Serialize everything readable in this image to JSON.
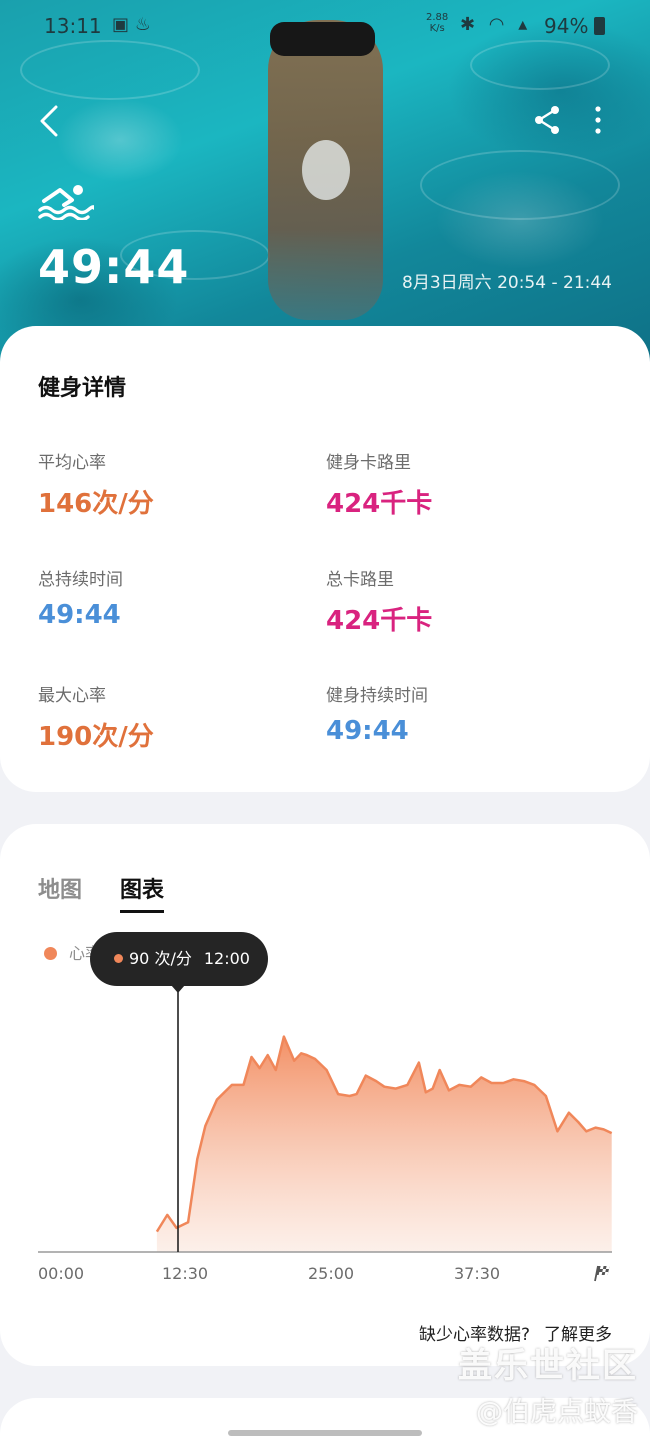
{
  "status_bar": {
    "time": "13:11",
    "left_icons": "▣ ♨",
    "net_speed_value": "2.88",
    "net_speed_unit": "K/s",
    "icons": "✱ ◠ ▴",
    "battery": "94%"
  },
  "hero": {
    "duration": "49:44",
    "date_range": "8月3日周六 20:54 - 21:44"
  },
  "details": {
    "title": "健身详情",
    "metrics": [
      {
        "label": "平均心率",
        "value": "146次/分",
        "color": "#e0713b"
      },
      {
        "label": "健身卡路里",
        "value": "424千卡",
        "color": "#d9237f"
      },
      {
        "label": "总持续时间",
        "value": "49:44",
        "color": "#4a8fd8"
      },
      {
        "label": "总卡路里",
        "value": "424千卡",
        "color": "#d9237f"
      },
      {
        "label": "最大心率",
        "value": "190次/分",
        "color": "#e0713b"
      },
      {
        "label": "健身持续时间",
        "value": "49:44",
        "color": "#4a8fd8"
      }
    ]
  },
  "chart_section": {
    "tabs": [
      "地图",
      "图表"
    ],
    "active_tab": "图表",
    "legend_label": "心率",
    "tooltip": {
      "value": "90 次/分",
      "time": "12:00"
    },
    "missing_text": "缺少心率数据?",
    "learn_more": "了解更多"
  },
  "chart_data": {
    "type": "area",
    "series_name": "心率",
    "color": "#f0875a",
    "x_ticks": [
      "00:00",
      "12:30",
      "25:00",
      "37:30"
    ],
    "x_range_min": [
      0,
      49.73
    ],
    "y_range": [
      60,
      200
    ],
    "x": [
      10.3,
      11.2,
      12.0,
      13.0,
      13.8,
      14.5,
      15.5,
      16.8,
      17.8,
      18.5,
      19.2,
      19.9,
      20.6,
      21.3,
      22.2,
      22.8,
      23.3,
      24.0,
      25.0,
      26.0,
      27.0,
      27.6,
      28.4,
      29.3,
      30.0,
      31.0,
      32.0,
      33.0,
      33.6,
      34.2,
      34.8,
      35.6,
      36.5,
      37.5,
      38.4,
      39.3,
      40.3,
      41.2,
      42.1,
      43.0,
      44.0,
      45.0,
      46.0,
      46.8,
      47.5,
      48.3,
      49.0,
      49.7
    ],
    "heart_rate": [
      71,
      80,
      73,
      76,
      110,
      128,
      142,
      150,
      150,
      165,
      159,
      166,
      158,
      176,
      163,
      167,
      166,
      164,
      158,
      145,
      144,
      145,
      155,
      152,
      149,
      148,
      150,
      162,
      146,
      148,
      158,
      147,
      150,
      149,
      154,
      151,
      151,
      153,
      152,
      150,
      144,
      125,
      135,
      130,
      125,
      127,
      126,
      124
    ],
    "markers": {
      "hover_time": "12:00",
      "hover_value": 90
    }
  },
  "watermark": {
    "line1": "盖乐世社区",
    "line2": "@伯虎点蚊香"
  }
}
